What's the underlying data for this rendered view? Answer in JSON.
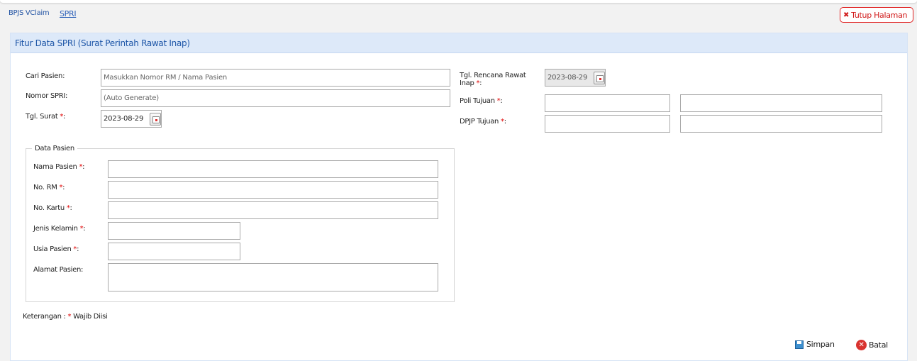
{
  "breadcrumb": {
    "item1": "BPJS VClaim",
    "item2": "SPRI"
  },
  "close_button": {
    "label": "Tutup Halaman"
  },
  "panel": {
    "title": "Fitur Data SPRI (Surat Perintah Rawat Inap)"
  },
  "form": {
    "cari_pasien": {
      "label": "Cari Pasien:",
      "placeholder": "Masukkan Nomor RM / Nama Pasien"
    },
    "nomor_spri": {
      "label": "Nomor SPRI:",
      "value": "(Auto Generate)"
    },
    "tgl_surat": {
      "label": "Tgl. Surat ",
      "suffix": ":",
      "value": "2023-08-29"
    },
    "tgl_rencana": {
      "label": "Tgl. Rencana Rawat Inap ",
      "suffix": ":",
      "value": "2023-08-29"
    },
    "poli_tujuan": {
      "label": "Poli Tujuan ",
      "suffix": ":"
    },
    "dpjp_tujuan": {
      "label": "DPJP Tujuan ",
      "suffix": ":"
    },
    "required_mark": "*"
  },
  "data_pasien": {
    "legend": "Data Pasien",
    "nama": {
      "label": "Nama Pasien ",
      "suffix": ":"
    },
    "no_rm": {
      "label": "No. RM ",
      "suffix": ":"
    },
    "no_kartu": {
      "label": "No. Kartu ",
      "suffix": ":"
    },
    "jenis_kelamin": {
      "label": "Jenis Kelamin ",
      "suffix": ":"
    },
    "usia": {
      "label": "Usia Pasien ",
      "suffix": ":"
    },
    "alamat": {
      "label": "Alamat Pasien:"
    }
  },
  "footer": {
    "note_prefix": "Keterangan : ",
    "note_suffix": " Wajib Diisi",
    "save_label": "Simpan",
    "cancel_label": "Batal"
  },
  "colors": {
    "accent": "#1f57a8",
    "required": "#e00000",
    "danger": "#d01818"
  }
}
